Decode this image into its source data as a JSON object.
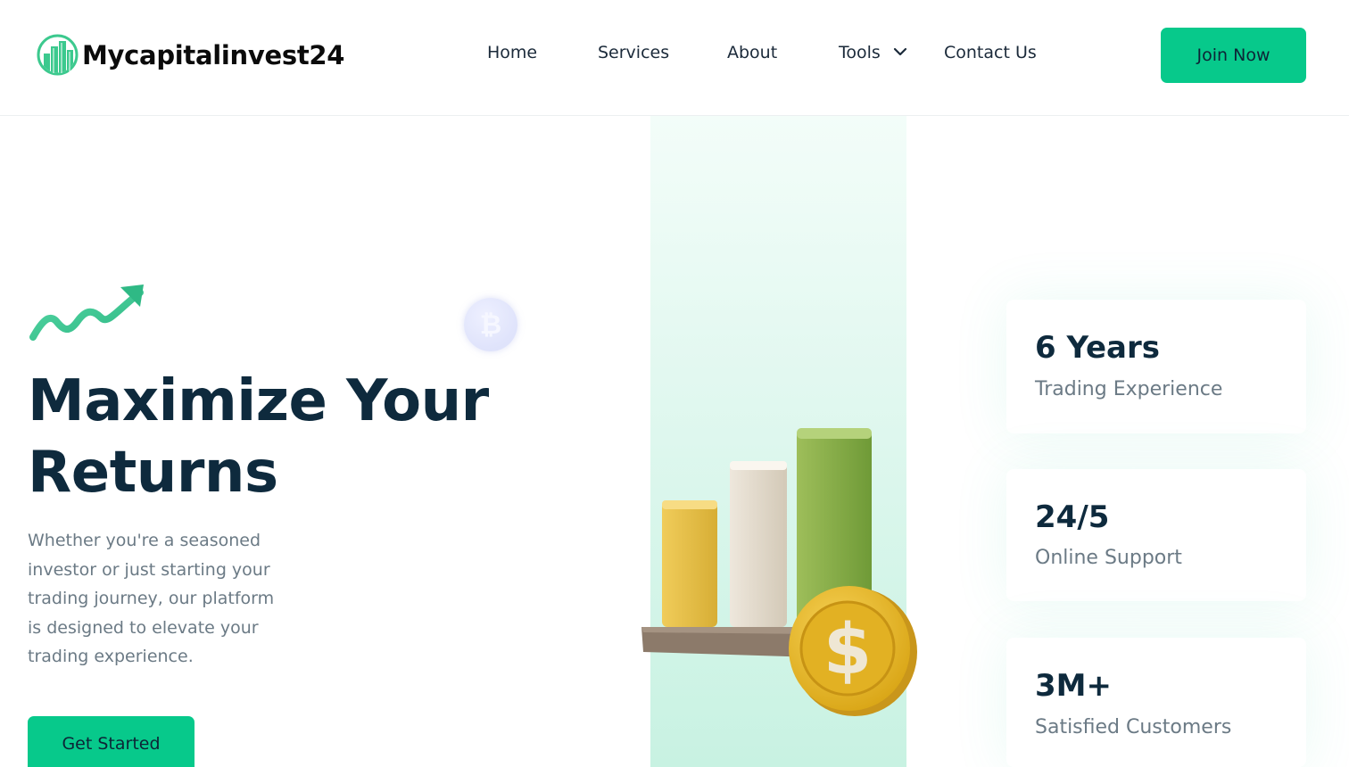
{
  "brand": {
    "name": "Mycapitalinvest24",
    "accent": "#07c98b",
    "dark": "#0e2a3d"
  },
  "nav": {
    "items": [
      {
        "label": "Home"
      },
      {
        "label": "Services"
      },
      {
        "label": "About"
      },
      {
        "label": "Tools",
        "has_dropdown": true
      },
      {
        "label": "Contact Us"
      }
    ],
    "cta_label": "Join Now"
  },
  "hero": {
    "headline_line1": "Maximize Your",
    "headline_line2": "Returns",
    "description": "Whether you're a seasoned investor or just starting your trading journey, our platform is designed to elevate your trading experience.",
    "cta_label": "Get Started",
    "icons": [
      "trend-up-arrow-icon",
      "bitcoin-coin-icon",
      "bar-chart-dollar-illustration"
    ]
  },
  "stats": [
    {
      "value": "6 Years",
      "label": "Trading Experience"
    },
    {
      "value": "24/5",
      "label": "Online Support"
    },
    {
      "value": "3M+",
      "label": "Satisfied Customers"
    }
  ]
}
